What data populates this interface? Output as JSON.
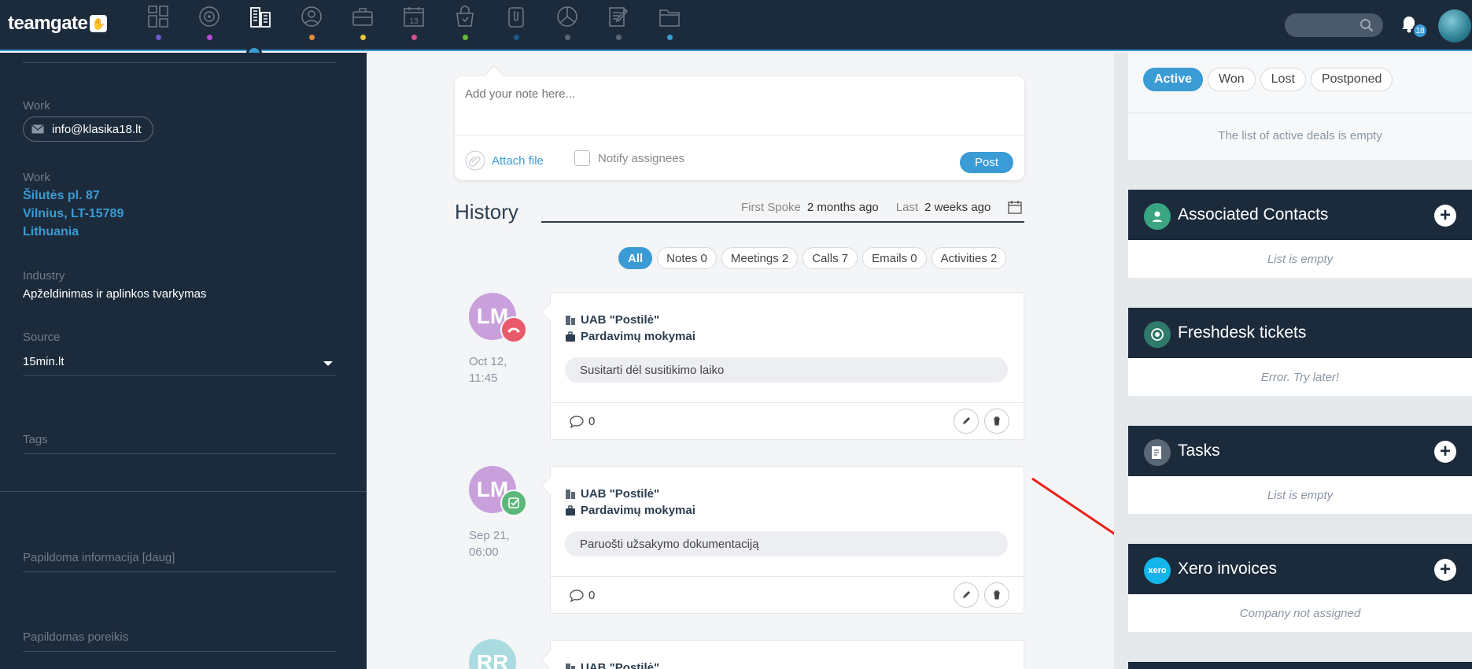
{
  "app": {
    "logo": "teamgate",
    "notifications_count": "18"
  },
  "colors": {
    "accent": "#3a9bd5",
    "dark": "#1c2b3c"
  },
  "nav": [
    {
      "name": "dashboard",
      "icon": "dashboard-icon",
      "dot": "#6a5acd"
    },
    {
      "name": "leads",
      "icon": "target-icon",
      "dot": "#b84fd8"
    },
    {
      "name": "companies",
      "icon": "buildings-icon",
      "dot": "#35b551",
      "active": true
    },
    {
      "name": "people",
      "icon": "person-icon",
      "dot": "#e88a3a"
    },
    {
      "name": "deals",
      "icon": "briefcase-icon",
      "dot": "#e8c53a"
    },
    {
      "name": "calendar",
      "icon": "calendar-icon",
      "dot": "#d94f8a"
    },
    {
      "name": "products",
      "icon": "bag-icon",
      "dot": "#6ab83a"
    },
    {
      "name": "documents",
      "icon": "clip-icon",
      "dot": "#1f5a8a"
    },
    {
      "name": "reports",
      "icon": "pie-chart-icon",
      "dot": "#5a6775"
    },
    {
      "name": "forms",
      "icon": "edit-icon",
      "dot": "#5a6775"
    },
    {
      "name": "files",
      "icon": "folder-icon",
      "dot": "#3a9bd5"
    }
  ],
  "left": {
    "email_label": "Work",
    "email": "info@klasika18.lt",
    "address_label": "Work",
    "address_lines": [
      "Šilutės pl. 87",
      "Vilnius, LT-15789",
      "Lithuania"
    ],
    "industry_label": "Industry",
    "industry": "Apželdinimas ir aplinkos tvarkymas",
    "source_label": "Source",
    "source": "15min.lt",
    "tags_label": "Tags",
    "extra_info_label": "Papildoma informacija [daug]",
    "extra_need_label": "Papildomas poreikis"
  },
  "note": {
    "placeholder": "Add your note here...",
    "attach": "Attach file",
    "notify": "Notify assignees",
    "post": "Post"
  },
  "history": {
    "title": "History",
    "first_spoke_label": "First Spoke",
    "first_spoke_value": "2 months ago",
    "last_label": "Last",
    "last_value": "2 weeks ago",
    "filters": [
      "All",
      "Notes 0",
      "Meetings 2",
      "Calls 7",
      "Emails 0",
      "Activities 2"
    ],
    "entries": [
      {
        "initials": "LM",
        "avatar_color": "#c9a0dc",
        "badge": "phone-hangup-icon",
        "badge_color": "#e85a6a",
        "date_line1": "Oct 12,",
        "date_line2": "11:45",
        "company": "UAB \"Postilė\"",
        "deal": "Pardavimų mokymai",
        "text": "Susitarti dėl susitikimo laiko",
        "comments": "0"
      },
      {
        "initials": "LM",
        "avatar_color": "#c9a0dc",
        "badge": "task-check-icon",
        "badge_color": "#5cb87a",
        "date_line1": "Sep 21,",
        "date_line2": "06:00",
        "company": "UAB \"Postilė\"",
        "deal": "Pardavimų mokymai",
        "text": "Paruošti užsakymo dokumentaciją",
        "comments": "0"
      },
      {
        "initials": "RR",
        "avatar_color": "#a9dbe0",
        "company": "UAB \"Postilė\""
      }
    ]
  },
  "right": {
    "deal_tabs": [
      "Active",
      "Won",
      "Lost",
      "Postponed"
    ],
    "deals_empty": "The list of active deals is empty",
    "panels": [
      {
        "title": "Associated Contacts",
        "body": "List is empty",
        "icon": "person-icon",
        "icon_color": "#3aa582"
      },
      {
        "title": "Freshdesk tickets",
        "body": "Error. Try later!",
        "icon": "freshdesk-icon",
        "icon_color": "#2f7a6a"
      },
      {
        "title": "Tasks",
        "body": "List is empty",
        "icon": "task-icon",
        "icon_color": "#5a6775"
      },
      {
        "title": "Xero invoices",
        "body": "Company not assigned",
        "icon": "xero-icon",
        "icon_color": "#13b5ea",
        "icon_text": "xero"
      }
    ]
  }
}
